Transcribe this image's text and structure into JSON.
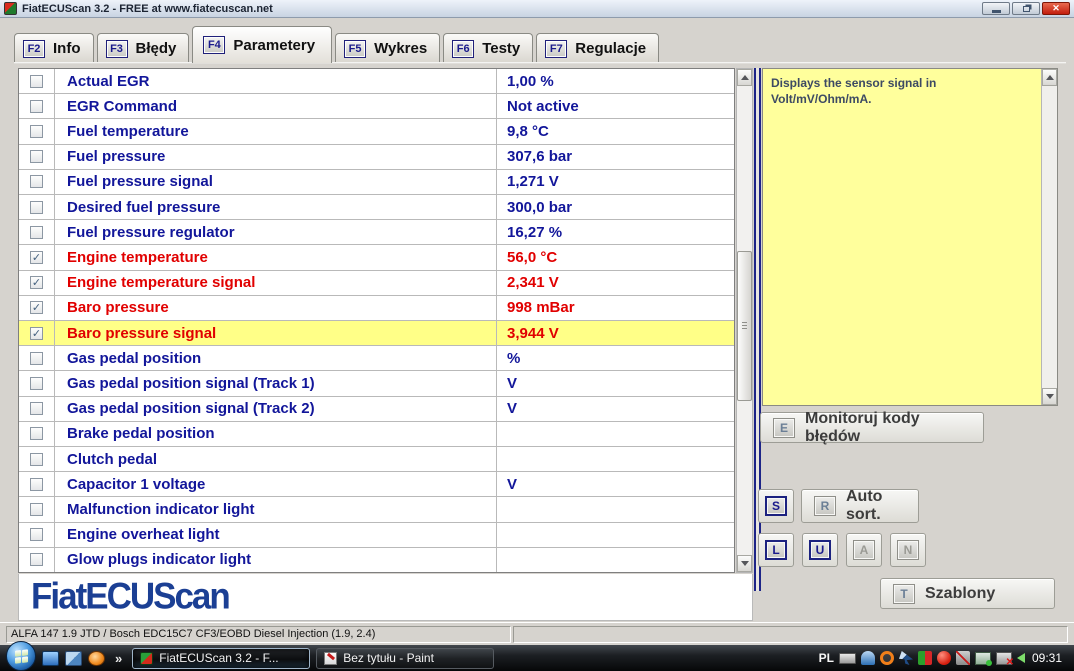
{
  "window": {
    "title": "FiatECUScan 3.2 - FREE at www.fiatecuscan.net"
  },
  "tabs": [
    {
      "id": "info",
      "key": "F2",
      "label": "Info",
      "active": false
    },
    {
      "id": "bledy",
      "key": "F3",
      "label": "Błędy",
      "active": false
    },
    {
      "id": "parametery",
      "key": "F4",
      "label": "Parametery",
      "active": true
    },
    {
      "id": "wykres",
      "key": "F5",
      "label": "Wykres",
      "active": false
    },
    {
      "id": "testy",
      "key": "F6",
      "label": "Testy",
      "active": false
    },
    {
      "id": "regulacje",
      "key": "F7",
      "label": "Regulacje",
      "active": false
    }
  ],
  "parameters": {
    "rows": [
      {
        "name": "Actual EGR",
        "value": "1,00 %",
        "checked": false,
        "red": false,
        "highlighted": false
      },
      {
        "name": "EGR Command",
        "value": "Not active",
        "checked": false,
        "red": false,
        "highlighted": false
      },
      {
        "name": "Fuel temperature",
        "value": "9,8 °C",
        "checked": false,
        "red": false,
        "highlighted": false
      },
      {
        "name": "Fuel pressure",
        "value": "307,6 bar",
        "checked": false,
        "red": false,
        "highlighted": false
      },
      {
        "name": "Fuel pressure signal",
        "value": "1,271 V",
        "checked": false,
        "red": false,
        "highlighted": false
      },
      {
        "name": "Desired fuel pressure",
        "value": "300,0 bar",
        "checked": false,
        "red": false,
        "highlighted": false
      },
      {
        "name": "Fuel pressure regulator",
        "value": "16,27 %",
        "checked": false,
        "red": false,
        "highlighted": false
      },
      {
        "name": "Engine temperature",
        "value": "56,0 °C",
        "checked": true,
        "red": true,
        "highlighted": false
      },
      {
        "name": "Engine temperature signal",
        "value": "2,341 V",
        "checked": true,
        "red": true,
        "highlighted": false
      },
      {
        "name": "Baro pressure",
        "value": "998 mBar",
        "checked": true,
        "red": true,
        "highlighted": false
      },
      {
        "name": "Baro pressure signal",
        "value": "3,944 V",
        "checked": true,
        "red": true,
        "highlighted": true
      },
      {
        "name": "Gas pedal position",
        "value": "%",
        "checked": false,
        "red": false,
        "highlighted": false
      },
      {
        "name": "Gas pedal position signal (Track 1)",
        "value": "V",
        "checked": false,
        "red": false,
        "highlighted": false
      },
      {
        "name": "Gas pedal position signal (Track 2)",
        "value": "V",
        "checked": false,
        "red": false,
        "highlighted": false
      },
      {
        "name": "Brake pedal position",
        "value": "",
        "checked": false,
        "red": false,
        "highlighted": false
      },
      {
        "name": "Clutch pedal",
        "value": "",
        "checked": false,
        "red": false,
        "highlighted": false
      },
      {
        "name": "Capacitor 1 voltage",
        "value": "V",
        "checked": false,
        "red": false,
        "highlighted": false
      },
      {
        "name": "Malfunction indicator light",
        "value": "",
        "checked": false,
        "red": false,
        "highlighted": false
      },
      {
        "name": "Engine overheat light",
        "value": "",
        "checked": false,
        "red": false,
        "highlighted": false
      },
      {
        "name": "Glow plugs indicator light",
        "value": "",
        "checked": false,
        "red": false,
        "highlighted": false
      }
    ]
  },
  "info_panel": {
    "text": "Displays the sensor signal in Volt/mV/Ohm/mA."
  },
  "actions": {
    "monitor": {
      "key": "E",
      "label": "Monitoruj kody błędów"
    },
    "s_button": {
      "key": "S",
      "enabled": true
    },
    "auto_sort": {
      "key": "R",
      "label": "Auto sort."
    },
    "small_keys": [
      {
        "key": "L",
        "enabled": true
      },
      {
        "key": "U",
        "enabled": true
      },
      {
        "key": "A",
        "enabled": false
      },
      {
        "key": "N",
        "enabled": false
      }
    ],
    "templates": {
      "key": "T",
      "label": "Szablony"
    }
  },
  "logo": {
    "text": "FiatECUScan"
  },
  "status_bar": {
    "text": "ALFA 147 1.9 JTD / Bosch EDC15C7 CF3/EOBD Diesel Injection (1.9, 2.4)"
  },
  "taskbar": {
    "overflow_chevron": "»",
    "tasks": [
      {
        "label": "FiatECUScan 3.2 - F...",
        "active": true
      },
      {
        "label": "Bez tytułu - Paint",
        "active": false
      }
    ],
    "tray": {
      "language": "PL",
      "time": "09:31"
    }
  },
  "icons": {
    "checkmark": "✓"
  },
  "colors": {
    "accent_navy": "#12169a",
    "alert_red": "#e10000",
    "row_highlight": "#ffff87",
    "info_panel_bg": "#ffff9c",
    "logo_blue": "#1b3f94"
  }
}
